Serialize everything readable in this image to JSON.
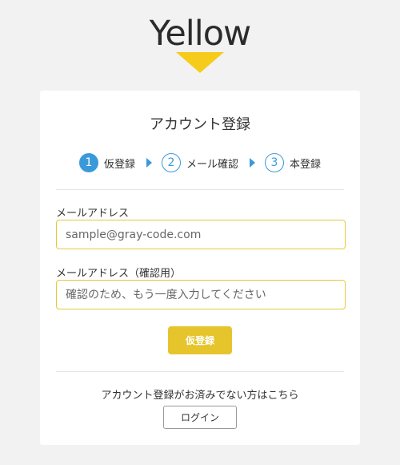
{
  "logo": {
    "text": "Yellow"
  },
  "card": {
    "title": "アカウント登録"
  },
  "steps": [
    {
      "number": "1",
      "label": "仮登録",
      "active": true
    },
    {
      "number": "2",
      "label": "メール確認",
      "active": false
    },
    {
      "number": "3",
      "label": "本登録",
      "active": false
    }
  ],
  "form": {
    "email_label": "メールアドレス",
    "email_placeholder": "sample@gray-code.com",
    "confirm_label": "メールアドレス（確認用）",
    "confirm_placeholder": "確認のため、もう一度入力してください",
    "submit_label": "仮登録"
  },
  "login": {
    "prompt": "アカウント登録がお済みでない方はこちら",
    "button_label": "ログイン"
  },
  "colors": {
    "brand_yellow": "#f5cc1c",
    "button_yellow": "#e6c52c",
    "step_blue": "#3a9ad9",
    "input_border": "#e6c937"
  }
}
